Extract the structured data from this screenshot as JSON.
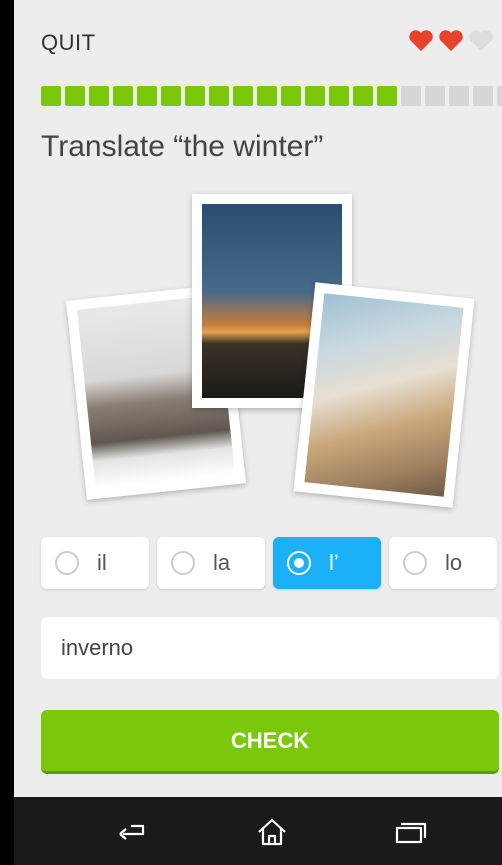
{
  "header": {
    "quit_label": "QUIT",
    "hearts": {
      "total": 3,
      "filled": 2,
      "filled_color": "#e8412c",
      "empty_color": "#dddddd"
    },
    "progress": {
      "total_segments": 20,
      "filled_segments": 15,
      "filled_color": "#7ac70c",
      "empty_color": "#d6d6d6"
    }
  },
  "prompt": "Translate “the winter”",
  "choices": [
    {
      "label": "il",
      "selected": false
    },
    {
      "label": "la",
      "selected": false
    },
    {
      "label": "l’",
      "selected": true
    },
    {
      "label": "lo",
      "selected": false
    }
  ],
  "answer": {
    "value": "inverno"
  },
  "check_label": "CHECK",
  "nav": {
    "back_icon": "back-icon",
    "home_icon": "home-icon",
    "recents_icon": "recents-icon"
  },
  "colors": {
    "accent_blue": "#1cb0f6",
    "check_green": "#7ac70c"
  }
}
